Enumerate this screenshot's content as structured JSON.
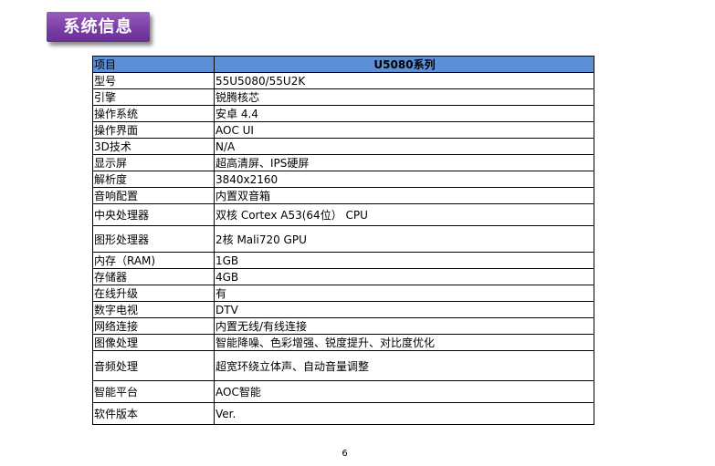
{
  "title": "系统信息",
  "table": {
    "header": [
      "项目",
      "U5080系列"
    ],
    "rows": [
      {
        "label": "型号",
        "value": "55U5080/55U2K"
      },
      {
        "label": "引擎",
        "value": "锐腾核芯"
      },
      {
        "label": "操作系统",
        "value": "安卓 4.4"
      },
      {
        "label": "操作界面",
        "value": "AOC UI"
      },
      {
        "label": "3D技术",
        "value": "N/A"
      },
      {
        "label": "显示屏",
        "value": "超高清屏、IPS硬屏"
      },
      {
        "label": "解析度",
        "value": "3840x2160"
      },
      {
        "label": "音响配置",
        "value": "内置双音箱"
      },
      {
        "label": "中央处理器",
        "value": "双核 Cortex A53(64位） CPU"
      },
      {
        "label": "图形处理器",
        "value": "2核 Mali720 GPU"
      },
      {
        "label": "内存（RAM)",
        "value": "1GB"
      },
      {
        "label": "存储器",
        "value": "4GB"
      },
      {
        "label": "在线升级",
        "value": "有"
      },
      {
        "label": "数字电视",
        "value": "DTV"
      },
      {
        "label": "网络连接",
        "value": "内置无线/有线连接"
      },
      {
        "label": "图像处理",
        "value": "智能降噪、色彩增强、锐度提升、对比度优化"
      },
      {
        "label": "音频处理",
        "value": " 超宽环绕立体声、自动音量调整"
      },
      {
        "label": "智能平台",
        "value": "AOC智能"
      },
      {
        "label": "软件版本",
        "value": "Ver."
      }
    ]
  },
  "page_number": "6",
  "colors": {
    "title_bg": "#7a3fa6",
    "header_bg": "#5b8fd6"
  }
}
